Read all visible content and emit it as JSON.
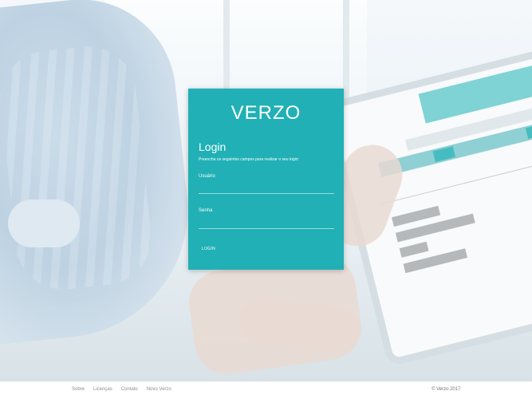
{
  "card": {
    "brand": "VERZO",
    "title": "Login",
    "subtitle": "Preencha os seguintes campos para realizar o seu login:",
    "username_label": "Usuário",
    "password_label": "Senha",
    "username_value": "",
    "password_value": "",
    "login_button": "LOGIN",
    "background_color": "#20b0b5"
  },
  "footer": {
    "links": [
      "Sobre",
      "Licenças",
      "Contato",
      "Novo Verzo"
    ],
    "copyright": "© Verzo 2017"
  }
}
